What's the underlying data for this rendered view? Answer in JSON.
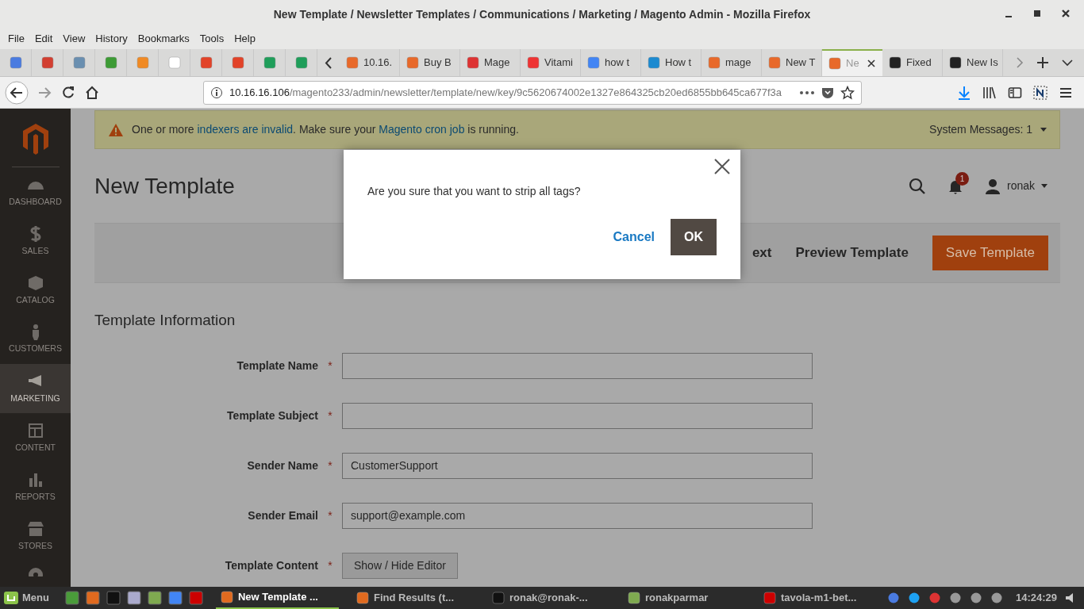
{
  "window": {
    "title": "New Template / Newsletter Templates / Communications / Marketing / Magento Admin - Mozilla Firefox"
  },
  "menu": [
    "File",
    "Edit",
    "View",
    "History",
    "Bookmarks",
    "Tools",
    "Help"
  ],
  "tabs": [
    {
      "label": "10.16.",
      "selected": false
    },
    {
      "label": "Buy B",
      "selected": false
    },
    {
      "label": "Mage",
      "selected": false
    },
    {
      "label": "Vitami",
      "selected": false
    },
    {
      "label": "how t",
      "selected": false
    },
    {
      "label": "How t",
      "selected": false
    },
    {
      "label": "mage",
      "selected": false
    },
    {
      "label": "New T",
      "selected": false
    },
    {
      "label": "Ne",
      "selected": true
    },
    {
      "label": "Fixed",
      "selected": false
    },
    {
      "label": "New Is",
      "selected": false
    }
  ],
  "address": {
    "host": "10.16.16.106",
    "path": "/magento233/admin/newsletter/template/new/key/9c5620674002e1327e864325cb20ed6855bb645ca677f3a"
  },
  "sidebar": [
    {
      "label": "DASHBOARD",
      "selected": false
    },
    {
      "label": "SALES",
      "selected": false
    },
    {
      "label": "CATALOG",
      "selected": false
    },
    {
      "label": "CUSTOMERS",
      "selected": false
    },
    {
      "label": "MARKETING",
      "selected": true
    },
    {
      "label": "CONTENT",
      "selected": false
    },
    {
      "label": "REPORTS",
      "selected": false
    },
    {
      "label": "STORES",
      "selected": false
    }
  ],
  "message": {
    "text": "One or more **indexers are invalid**. Make sure your **Magento cron job** is running.",
    "system_messages": "System Messages: 1"
  },
  "page": {
    "title": "New Template",
    "user": "ronak",
    "notifications": "1"
  },
  "actions": [
    {
      "label": "ext",
      "kind": "plain"
    },
    {
      "label": "Preview Template",
      "kind": "plain"
    },
    {
      "label": "Save Template",
      "kind": "primary"
    }
  ],
  "section_title": "Template Information",
  "fields": [
    {
      "label": "Template Name",
      "required_mark": "*",
      "kind": "input"
    },
    {
      "label": "Template Subject",
      "required_mark": "*",
      "kind": "input"
    },
    {
      "label": "Sender Name",
      "required_mark": "*",
      "value": "CustomerSupport",
      "kind": "input"
    },
    {
      "label": "Sender Email",
      "required_mark": "*",
      "value": "support@example.com",
      "kind": "input"
    },
    {
      "label": "Template Content",
      "required_mark": "*",
      "value": "Show / Hide Editor",
      "kind": "button"
    }
  ],
  "modal": {
    "text": "Are you sure that you want to strip all tags?",
    "cancel": "Cancel",
    "ok": "OK"
  },
  "taskbar": {
    "menu": "Menu",
    "windows": [
      {
        "label": "New Template ...",
        "selected": true
      },
      {
        "label": "Find Results (t...",
        "selected": false
      },
      {
        "label": "ronak@ronak-...",
        "selected": false
      },
      {
        "label": "ronakparmar",
        "selected": false
      },
      {
        "label": "tavola-m1-bet...",
        "selected": false
      }
    ],
    "clock": "14:24:29"
  }
}
